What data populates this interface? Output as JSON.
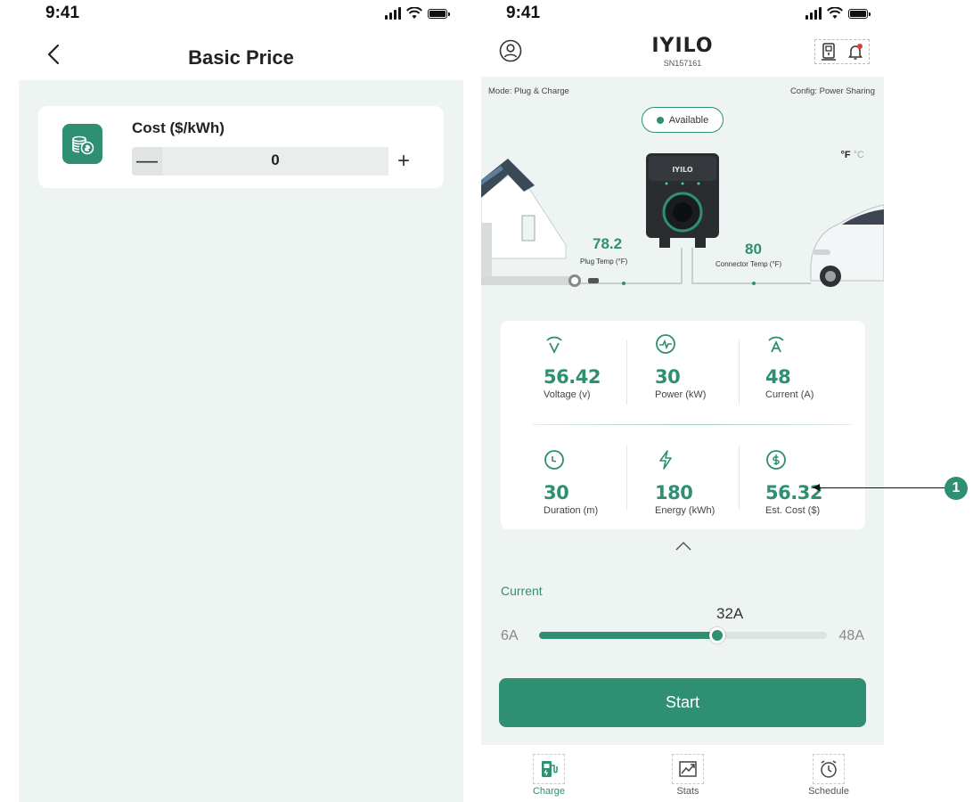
{
  "left_screen": {
    "status_time": "9:41",
    "title": "Basic Price",
    "cost_label": "Cost ($/kWh)",
    "cost_value": "0",
    "minus_label": "—",
    "plus_label": "+"
  },
  "right_screen": {
    "status_time": "9:41",
    "brand": "IYILO",
    "serial": "SN157161",
    "mode": "Mode: Plug & Charge",
    "config": "Config: Power Sharing",
    "status": "Available",
    "unit_f": "°F",
    "unit_c": "°C",
    "charger_brand": "IYILO",
    "plug_temp": {
      "value": "78.2",
      "label": "Plug Temp (°F)"
    },
    "connector_temp": {
      "value": "80",
      "label": "Connector Temp (°F)"
    },
    "stats": [
      {
        "value": "56.42",
        "label": "Voltage (v)",
        "icon": "voltage-icon"
      },
      {
        "value": "30",
        "label": "Power (kW)",
        "icon": "power-icon"
      },
      {
        "value": "48",
        "label": "Current (A)",
        "icon": "current-icon"
      },
      {
        "value": "30",
        "label": "Duration (m)",
        "icon": "clock-icon"
      },
      {
        "value": "180",
        "label": "Energy (kWh)",
        "icon": "lightning-icon"
      },
      {
        "value": "56.32",
        "label": "Est. Cost ($)",
        "icon": "dollar-icon"
      }
    ],
    "current_section": {
      "label": "Current",
      "value": "32A",
      "min": "6A",
      "max": "48A",
      "min_amps": 6,
      "max_amps": 48,
      "current_amps": 32
    },
    "start_label": "Start",
    "tabs": [
      {
        "label": "Charge",
        "active": true
      },
      {
        "label": "Stats",
        "active": false
      },
      {
        "label": "Schedule",
        "active": false
      }
    ]
  },
  "callout": {
    "number": "1"
  },
  "colors": {
    "accent": "#2f8f72",
    "background": "#eef4f1"
  }
}
